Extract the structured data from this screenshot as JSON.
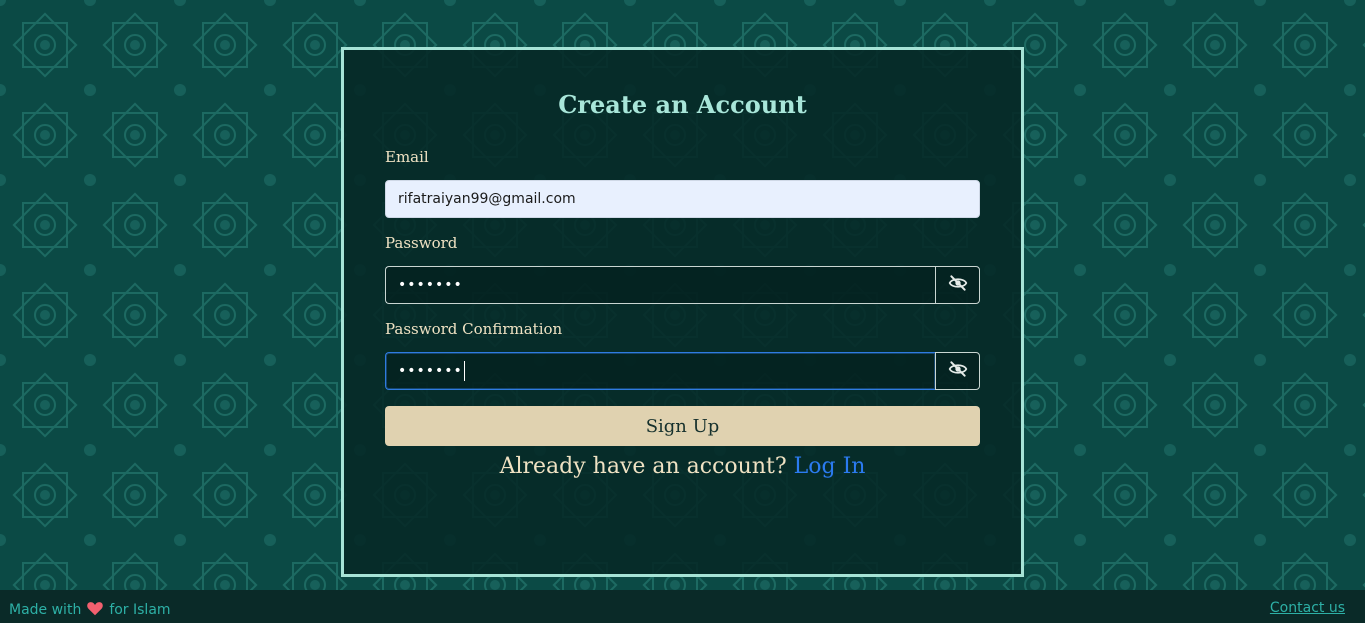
{
  "form": {
    "title": "Create an Account",
    "email_label": "Email",
    "email_value": "rifatraiyan99@gmail.com",
    "password_label": "Password",
    "password_value": "•••••••",
    "password_confirm_label": "Password Confirmation",
    "password_confirm_value": "•••••••",
    "submit_label": "Sign Up",
    "login_prompt": "Already have an account?",
    "login_link": "Log In"
  },
  "footer": {
    "made_with": "Made with",
    "for_islam": "for Islam",
    "contact": "Contact us"
  },
  "icons": {
    "eye": "eye-slash-icon",
    "heart": "heart-icon"
  },
  "colors": {
    "background": "#0b4a45",
    "card_border": "#a6e3d6",
    "title": "#a8e6d9",
    "button": "#e0d2b0",
    "link": "#2b7bf0",
    "footer_text": "#2db0a6",
    "heart": "#f2606f"
  }
}
